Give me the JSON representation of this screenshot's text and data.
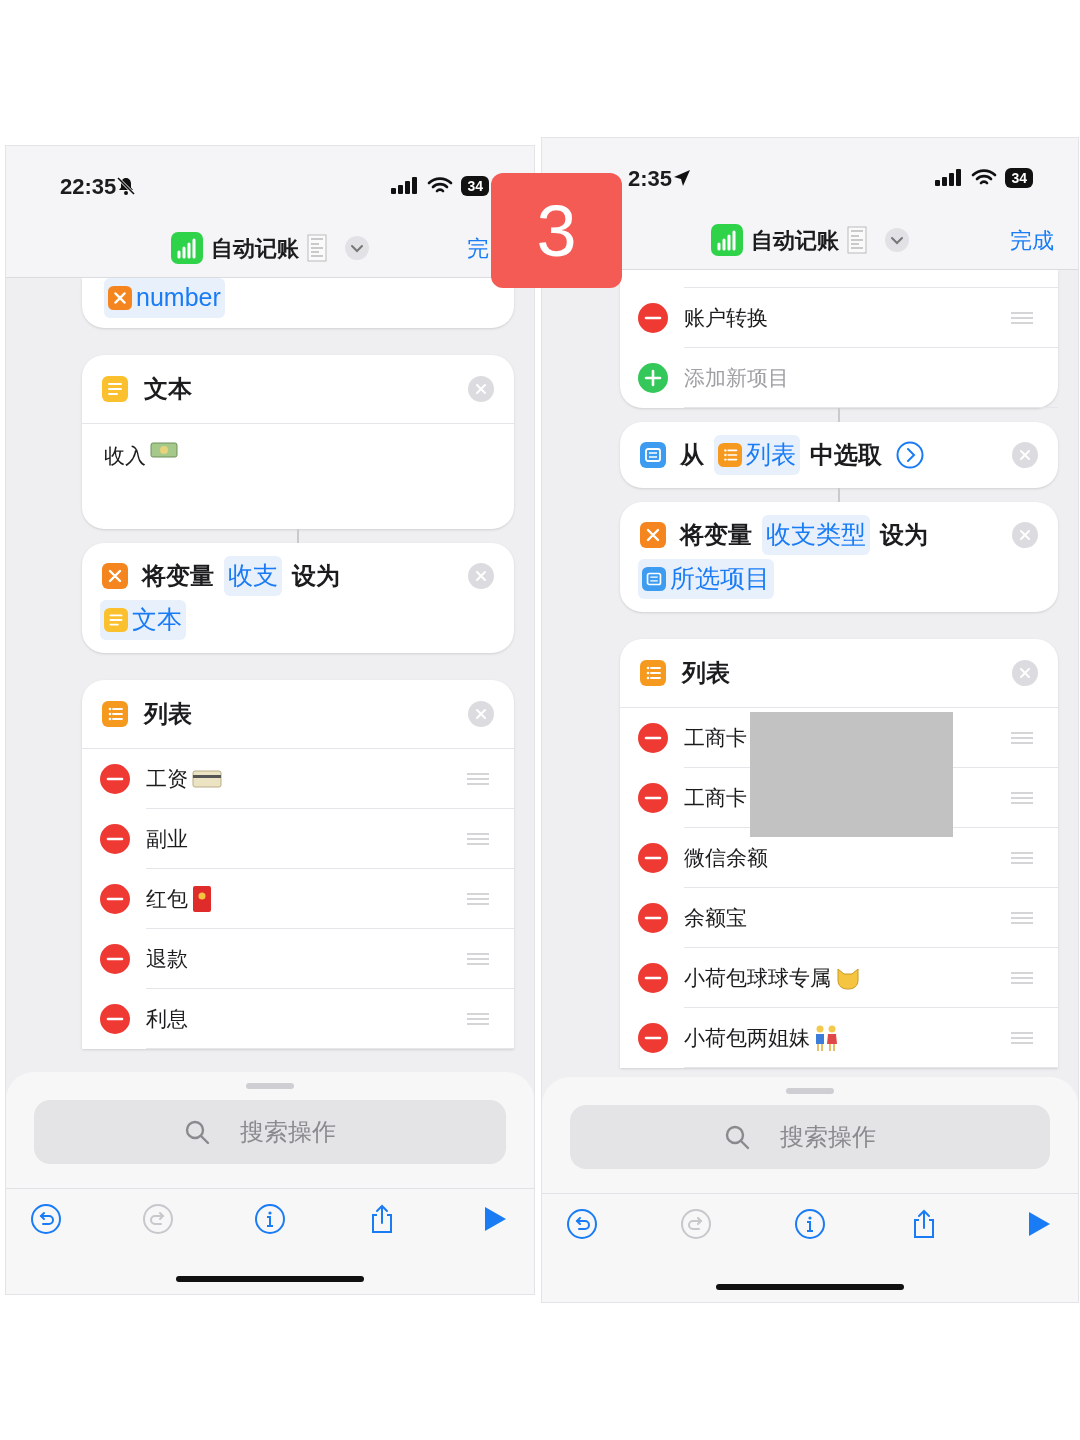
{
  "badge": "3",
  "phones": [
    {
      "status": {
        "time": "22:35",
        "muted": true,
        "location": false,
        "battery": "34"
      },
      "header": {
        "title": "自动记账",
        "done": "完"
      },
      "cards": [
        {
          "kind": "token_tail",
          "linked": false,
          "token": {
            "kind": "variable",
            "text": "number"
          }
        },
        {
          "kind": "text",
          "linked": false,
          "title": "文本",
          "body": {
            "kind": "cash",
            "text": "收入"
          }
        },
        {
          "kind": "set_variable",
          "linked": true,
          "more": false,
          "lines": [
            [
              {
                "kind": "text",
                "text": "将变量"
              },
              {
                "kind": "plain_token",
                "text": "收支"
              },
              {
                "kind": "text",
                "text": "设为"
              }
            ],
            [
              {
                "kind": "text_token",
                "text": "文本"
              }
            ]
          ]
        },
        {
          "kind": "list",
          "linked": false,
          "title": "列表",
          "redacted": false,
          "items": [
            {
              "kind": "card",
              "text": "工资"
            },
            {
              "kind": "item",
              "text": "副业"
            },
            {
              "kind": "envelope",
              "text": "红包"
            },
            {
              "kind": "item",
              "text": "退款"
            },
            {
              "kind": "item",
              "text": "利息"
            }
          ]
        }
      ],
      "search": {
        "placeholder": "搜索操作"
      },
      "toolbar": [
        {
          "kind": "undo",
          "disabled": false
        },
        {
          "kind": "redo",
          "disabled": true
        },
        {
          "kind": "info",
          "disabled": false
        },
        {
          "kind": "share",
          "disabled": false
        },
        {
          "kind": "run",
          "disabled": false
        }
      ]
    },
    {
      "status": {
        "time": "2:35",
        "muted": false,
        "location": true,
        "battery": "34"
      },
      "header": {
        "title": "自动记账",
        "done": "完成"
      },
      "cards": [
        {
          "kind": "list_tail",
          "linked": false,
          "items": [
            {
              "kind": "item",
              "text": "账户转换"
            },
            {
              "kind": "add",
              "text": "添加新项目"
            }
          ]
        },
        {
          "kind": "choose",
          "linked": true,
          "more": true,
          "lines": [
            [
              {
                "kind": "text",
                "text": "从"
              },
              {
                "kind": "list_token",
                "text": "列表"
              },
              {
                "kind": "text",
                "text": "中选取"
              }
            ]
          ]
        },
        {
          "kind": "set_variable",
          "linked": true,
          "more": false,
          "lines": [
            [
              {
                "kind": "text",
                "text": "将变量"
              },
              {
                "kind": "plain_token",
                "text": "收支类型"
              },
              {
                "kind": "text",
                "text": "设为"
              }
            ],
            [
              {
                "kind": "menu_token",
                "text": "所选项目"
              }
            ]
          ]
        },
        {
          "kind": "list",
          "linked": false,
          "title": "列表",
          "redacted": true,
          "items": [
            {
              "kind": "item",
              "text": "工商卡"
            },
            {
              "kind": "item",
              "text": "工商卡"
            },
            {
              "kind": "item",
              "text": "微信余额"
            },
            {
              "kind": "item",
              "text": "余额宝"
            },
            {
              "kind": "cat",
              "text": "小荷包球球专属"
            },
            {
              "kind": "figures",
              "text": "小荷包两姐妹"
            }
          ]
        }
      ],
      "search": {
        "placeholder": "搜索操作"
      },
      "toolbar": [
        {
          "kind": "undo",
          "disabled": false
        },
        {
          "kind": "redo",
          "disabled": true
        },
        {
          "kind": "info",
          "disabled": false
        },
        {
          "kind": "share",
          "disabled": false
        },
        {
          "kind": "run",
          "disabled": false
        }
      ]
    }
  ]
}
